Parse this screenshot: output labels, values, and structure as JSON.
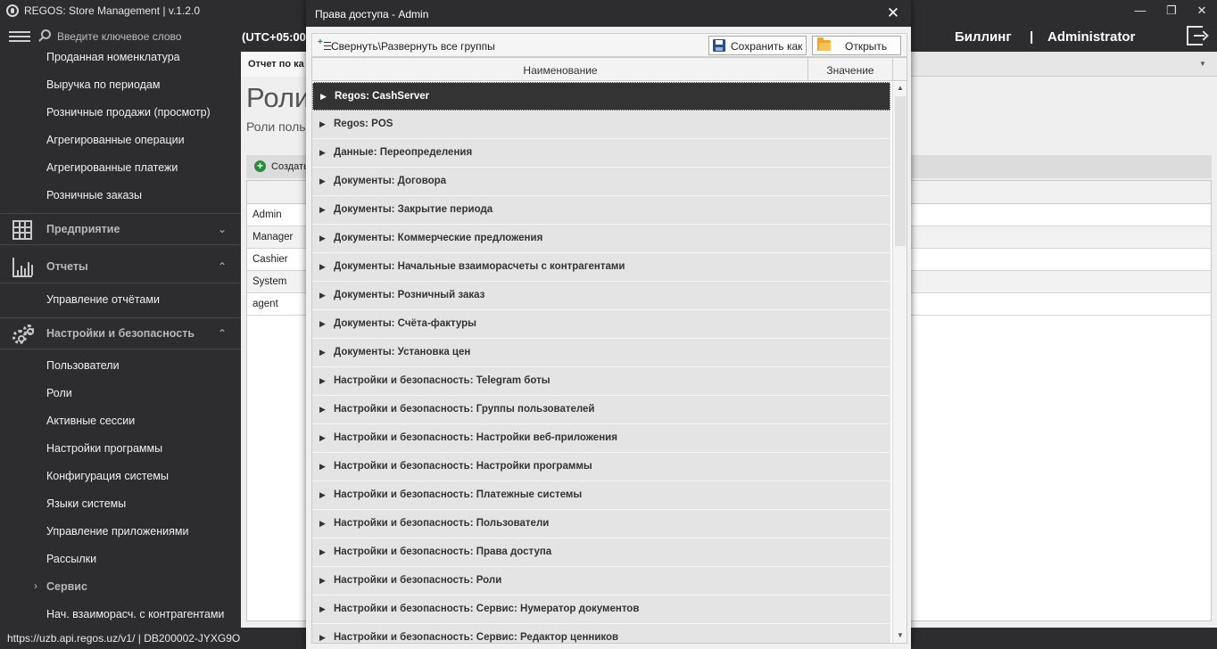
{
  "app": {
    "title": "REGOS: Store Management | v.1.2.0",
    "minimize": "—",
    "maximize": "❐",
    "close": "✕"
  },
  "topbar": {
    "search_placeholder": "Введите ключевое слово",
    "timezone": "(UTC+05:00)",
    "billing": "Биллинг",
    "separator": "|",
    "user": "Administrator"
  },
  "sidebar": {
    "report_items": [
      "Проданная номенклатура",
      "Выручка по периодам",
      "Розничные продажи (просмотр)",
      "Агрегированные операции",
      "Агрегированные платежи",
      "Розничные заказы"
    ],
    "group_enterprise": "Предприятие",
    "group_reports": "Отчеты",
    "reports_sub": [
      "Управление отчётами"
    ],
    "group_settings": "Настройки и безопасность",
    "settings_items": [
      "Пользователи",
      "Роли",
      "Активные сессии",
      "Настройки программы",
      "Конфигурация системы",
      "Языки системы",
      "Управление приложениями",
      "Рассылки"
    ],
    "service": "Сервис",
    "last_item": "Нач. взаиморасч. с контрагентами"
  },
  "status": {
    "text": "https://uzb.api.regos.uz/v1/ | DB200002-JYXG9O"
  },
  "content": {
    "tab_label": "Отчет по ка",
    "page_title": "Роли",
    "page_subtitle": "Роли поль",
    "create_label": "Создать",
    "roles": [
      "Admin",
      "Manager",
      "Cashier",
      "System",
      "agent"
    ]
  },
  "dialog": {
    "title": "Права доступа - Admin",
    "close": "✕",
    "collapse_label": "Свернуть\\Развернуть все группы",
    "save_as": "Сохранить как",
    "open": "Открыть",
    "col_name": "Наименование",
    "col_value": "Значение",
    "groups": [
      "Regos: CashServer",
      "Regos: POS",
      "Данные: Переопределения",
      "Документы: Договора",
      "Документы: Закрытие периода",
      "Документы: Коммерческие предложения",
      "Документы: Начальные взаиморасчеты с контрагентами",
      "Документы: Розничный заказ",
      "Документы: Счёта-фактуры",
      "Документы: Установка цен",
      "Настройки и безопасность: Telegram боты",
      "Настройки и безопасность: Группы пользователей",
      "Настройки и безопасность: Настройки веб-приложения",
      "Настройки и безопасность: Настройки программы",
      "Настройки и безопасность: Платежные системы",
      "Настройки и безопасность: Пользователи",
      "Настройки и безопасность: Права доступа",
      "Настройки и безопасность: Роли",
      "Настройки и безопасность: Сервис: Нумератор документов",
      "Настройки и безопасность: Сервис: Редактор ценников"
    ]
  },
  "colors": {
    "chrome": "#2d2d30",
    "row_bg": "#e4e4e4",
    "selected_row": "#333333",
    "accent_green": "#2c8a3c"
  }
}
